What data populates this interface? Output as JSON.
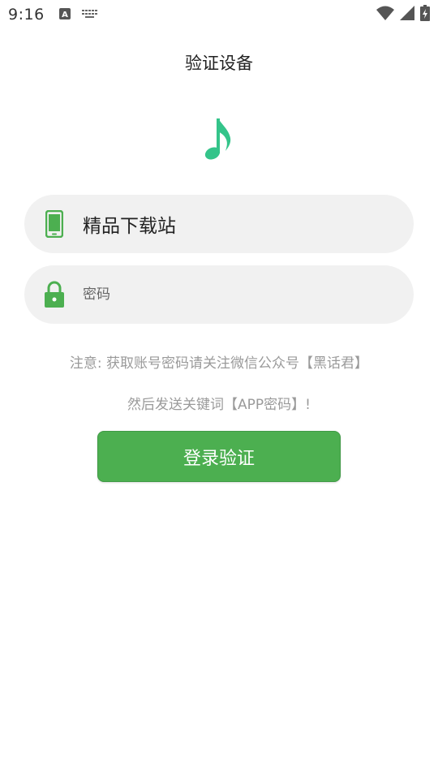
{
  "status_bar": {
    "time": "9:16",
    "icons": [
      "a-letter-icon",
      "keyboard-icon",
      "wifi-icon",
      "signal-icon",
      "battery-charging-icon"
    ]
  },
  "page": {
    "title": "验证设备"
  },
  "form": {
    "username_value": "精品下载站",
    "password_placeholder": "密码"
  },
  "notice": {
    "line1": "注意: 获取账号密码请关注微信公众号【黑话君】",
    "line2": "然后发送关键词【APP密码】!"
  },
  "actions": {
    "login_label": "登录验证"
  },
  "colors": {
    "accent": "#4caf50",
    "logo": "#34c48a",
    "field_bg": "#f1f1f1",
    "notice_text": "#9a9a9a"
  }
}
